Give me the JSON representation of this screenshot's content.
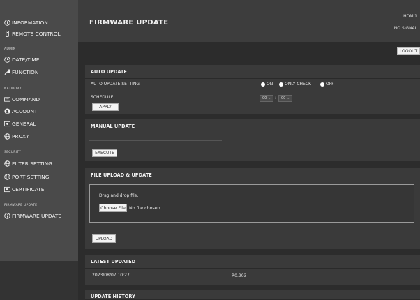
{
  "sidebar": {
    "top_items": [
      {
        "label": "INFORMATION",
        "icon": "info-icon"
      },
      {
        "label": "REMOTE CONTROL",
        "icon": "remote-icon"
      }
    ],
    "sections": [
      {
        "label": "ADMIN",
        "items": [
          {
            "label": "DATE/TIME",
            "icon": "clock-icon"
          },
          {
            "label": "FUNCTION",
            "icon": "wrench-icon"
          }
        ]
      },
      {
        "label": "NETWORK",
        "items": [
          {
            "label": "COMMAND",
            "icon": "keyboard-icon"
          },
          {
            "label": "ACCOUNT",
            "icon": "account-icon"
          },
          {
            "label": "GENERAL",
            "icon": "general-icon"
          },
          {
            "label": "PROXY",
            "icon": "globe-icon"
          }
        ]
      },
      {
        "label": "SECURITY",
        "items": [
          {
            "label": "FILTER SETTING",
            "icon": "globe-icon"
          },
          {
            "label": "PORT SETTING",
            "icon": "globe-icon"
          },
          {
            "label": "CERTIFICATE",
            "icon": "certificate-icon"
          }
        ]
      },
      {
        "label": "FIRMWARE UPDATE",
        "items": [
          {
            "label": "FIRMWARE UPDATE",
            "icon": "info-icon"
          }
        ]
      }
    ]
  },
  "header": {
    "title": "FIRMWARE UPDATE",
    "input": "HDMI1",
    "signal": "NO SIGNAL",
    "logout": "LOGOUT"
  },
  "auto_update": {
    "title": "AUTO UPDATE",
    "setting_label": "AUTO UPDATE SETTING",
    "options": [
      "ON",
      "ONLY CHECK",
      "OFF"
    ],
    "schedule_label": "SCHEDULE",
    "hour": "00",
    "minute": "00",
    "separator": ":",
    "apply": "APPLY"
  },
  "manual_update": {
    "title": "MANUAL UPDATE",
    "execute": "EXECUTE"
  },
  "file_upload": {
    "title": "FILE UPLOAD & UPDATE",
    "drop_text": "Drag and drop file.",
    "choose_file": "Choose File",
    "file_status": "No file chosen",
    "upload": "UPLOAD"
  },
  "latest_updated": {
    "title": "LATEST UPDATED",
    "datetime": "2023/08/07 10:27",
    "version": "R0.903"
  },
  "update_history": {
    "title": "UPDATE HISTORY"
  }
}
